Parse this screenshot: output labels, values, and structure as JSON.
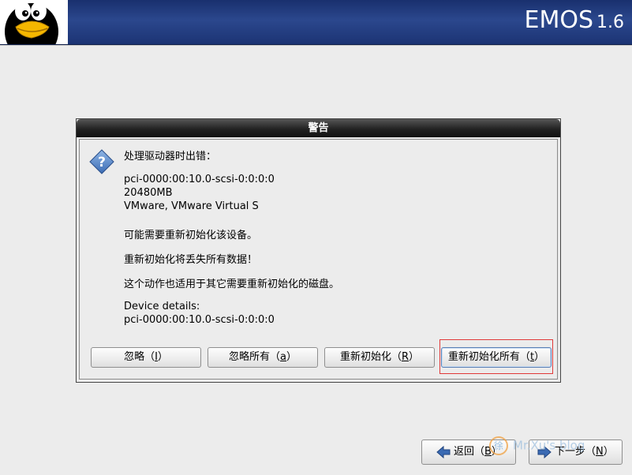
{
  "header": {
    "brand": "EMOS",
    "version": "1.6"
  },
  "dialog": {
    "title": "警告",
    "lines": [
      "处理驱动器时出错：",
      "pci-0000:00:10.0-scsi-0:0:0:0",
      "20480MB",
      "VMware, VMware Virtual S",
      "可能需要重新初始化该设备。",
      "重新初始化将丢失所有数据！",
      "这个动作也适用于其它需要重新初始化的磁盘。",
      "Device details:",
      "pci-0000:00:10.0-scsi-0:0:0:0"
    ],
    "buttons": {
      "ignore": {
        "label": "忽略（",
        "key": "I",
        "tail": "）"
      },
      "ignore_all": {
        "label": "忽略所有（",
        "key": "a",
        "tail": "）"
      },
      "reinit": {
        "label": "重新初始化（",
        "key": "R",
        "tail": "）"
      },
      "reinit_all": {
        "label": "重新初始化所有（",
        "key": "t",
        "tail": "）"
      }
    }
  },
  "nav": {
    "back": {
      "label": "返回（",
      "key": "B",
      "tail": "）"
    },
    "next": {
      "label": "下一步（",
      "key": "N",
      "tail": "）"
    }
  },
  "watermark": {
    "symbol": "徐",
    "text": "Mr.Xu's blog"
  },
  "colors": {
    "banner": "#2b478d",
    "dialog_title": "#222222",
    "focus_ring": "#e03a3a",
    "arrow": "#3a6ab3"
  }
}
